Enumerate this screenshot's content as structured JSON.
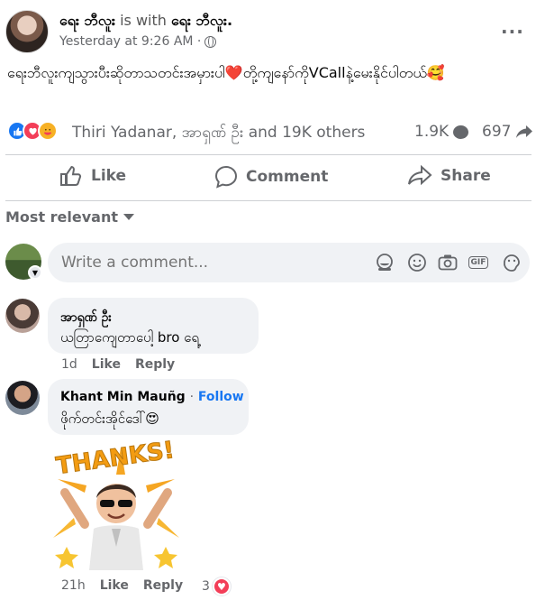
{
  "post": {
    "author": "ရေး ဘီလူး",
    "with_text": "is with",
    "tagged": "ရေး ဘီလူး.",
    "timestamp": "Yesterday at 9:26 AM ·",
    "privacy_icon": "globe-icon",
    "text": "ရေးဘီလူးကျသွားပီးဆိုတာသတင်းအမှားပါ❤️တို့ကျနော်ကိုVCallနဲ့မေးနိုင်ပါတယ်🥰",
    "more_icon": "more-options-icon"
  },
  "reactions": {
    "icons": [
      "like-icon",
      "love-icon",
      "care-icon"
    ],
    "names": "Thiri Yadanar, အာရှဏ် ဦး and 19K others",
    "comments_count": "1.9K",
    "shares_count": "697"
  },
  "actions": {
    "like": "Like",
    "comment": "Comment",
    "share": "Share"
  },
  "sort": {
    "label": "Most relevant"
  },
  "composer": {
    "placeholder": "Write a comment..."
  },
  "comments": [
    {
      "name": "အာရှဏ် ဦး",
      "text": "ယတြာကျေတာပေါ့ bro ရေ့",
      "time": "1d",
      "like": "Like",
      "reply": "Reply"
    },
    {
      "name": "Khant Min Mauñg",
      "follow": "Follow",
      "separator": "·",
      "text": "ဖိုက်တင်းအိုင်ဒေါ်😍",
      "sticker_text": "THANKS!",
      "time": "21h",
      "like": "Like",
      "reply": "Reply",
      "reaction_count": "3"
    }
  ],
  "colors": {
    "accent": "#1877f2",
    "muted": "#65676b",
    "bubble": "#f0f2f5",
    "love": "#f33e58"
  }
}
